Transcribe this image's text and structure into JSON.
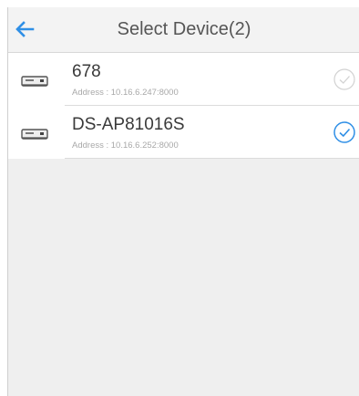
{
  "header": {
    "title": "Select Device(2)",
    "back_icon": "back-arrow-icon",
    "accent": "#2f8fe6"
  },
  "devices": [
    {
      "name": "678",
      "address": "Address :  10.16.6.247:8000",
      "selected": false
    },
    {
      "name": "DS-AP81016S",
      "address": "Address :  10.16.6.252:8000",
      "selected": true
    }
  ],
  "colors": {
    "selected": "#2f8fe6",
    "unselected": "#c8c8c8",
    "background": "#efefef"
  }
}
